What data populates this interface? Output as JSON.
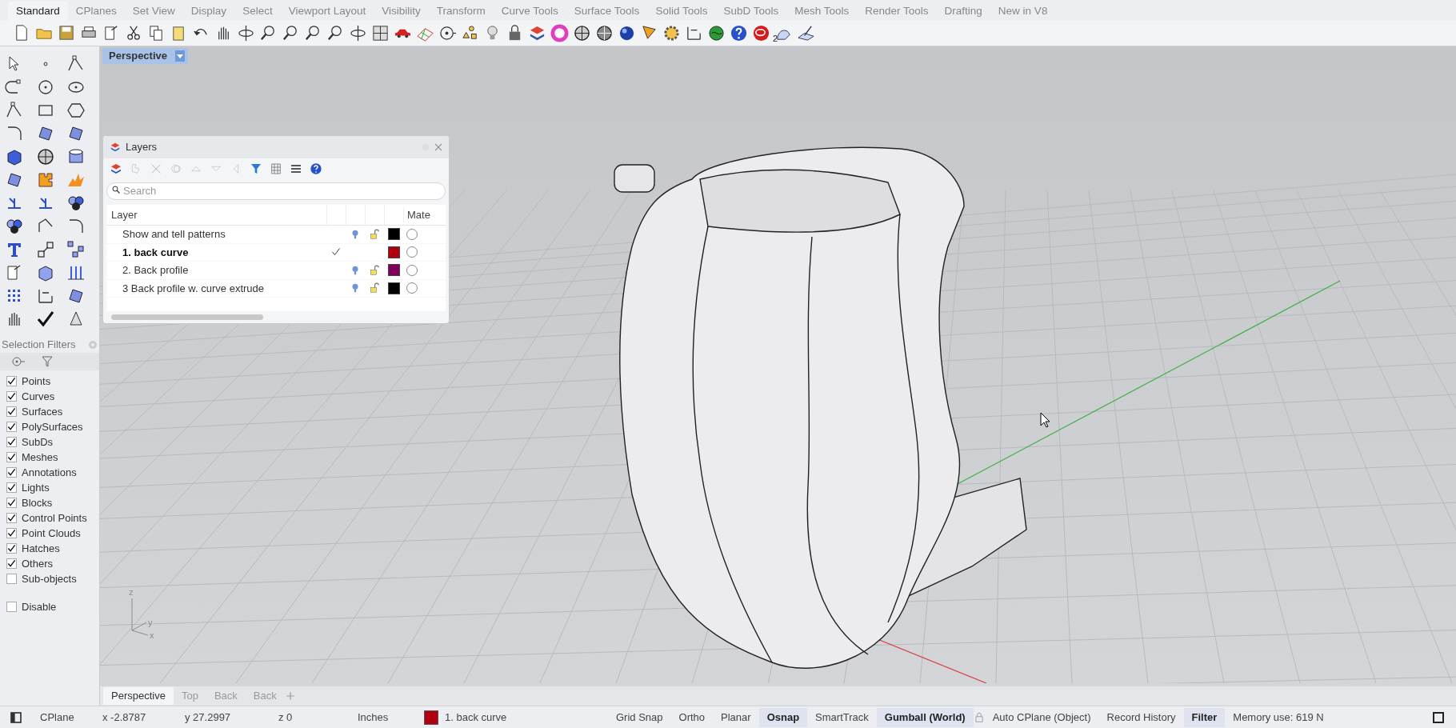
{
  "menu_tabs": [
    {
      "label": "Standard",
      "selected": true
    },
    {
      "label": "CPlanes",
      "selected": false
    },
    {
      "label": "Set View",
      "selected": false
    },
    {
      "label": "Display",
      "selected": false
    },
    {
      "label": "Select",
      "selected": false
    },
    {
      "label": "Viewport Layout",
      "selected": false
    },
    {
      "label": "Visibility",
      "selected": false
    },
    {
      "label": "Transform",
      "selected": false
    },
    {
      "label": "Curve Tools",
      "selected": false
    },
    {
      "label": "Surface Tools",
      "selected": false
    },
    {
      "label": "Solid Tools",
      "selected": false
    },
    {
      "label": "SubD Tools",
      "selected": false
    },
    {
      "label": "Mesh Tools",
      "selected": false
    },
    {
      "label": "Render Tools",
      "selected": false
    },
    {
      "label": "Drafting",
      "selected": false
    },
    {
      "label": "New in V8",
      "selected": false
    }
  ],
  "toolbar_badge": "2",
  "viewport": {
    "title": "Perspective",
    "axes": {
      "x": "x",
      "y": "y",
      "z": "z"
    }
  },
  "layers_panel": {
    "title": "Layers",
    "search": {
      "placeholder": "Search"
    },
    "columns": [
      "Layer",
      "Mate"
    ],
    "rows": [
      {
        "name": "Show and tell patterns",
        "current": false,
        "color": "#000000"
      },
      {
        "name": "1. back curve",
        "current": true,
        "color": "#b00010"
      },
      {
        "name": "2. Back profile",
        "current": false,
        "color": "#800060"
      },
      {
        "name": "3 Back profile w. curve extrude",
        "current": false,
        "color": "#000000"
      }
    ]
  },
  "selection_filters": {
    "title": "Selection Filters",
    "items": [
      {
        "label": "Points",
        "checked": true
      },
      {
        "label": "Curves",
        "checked": true
      },
      {
        "label": "Surfaces",
        "checked": true
      },
      {
        "label": "PolySurfaces",
        "checked": true
      },
      {
        "label": "SubDs",
        "checked": true
      },
      {
        "label": "Meshes",
        "checked": true
      },
      {
        "label": "Annotations",
        "checked": true
      },
      {
        "label": "Lights",
        "checked": true
      },
      {
        "label": "Blocks",
        "checked": true
      },
      {
        "label": "Control Points",
        "checked": true
      },
      {
        "label": "Point Clouds",
        "checked": true
      },
      {
        "label": "Hatches",
        "checked": true
      },
      {
        "label": "Others",
        "checked": true
      },
      {
        "label": "Sub-objects",
        "checked": false
      }
    ],
    "disable": {
      "label": "Disable",
      "checked": false
    }
  },
  "viewport_tabs": [
    {
      "label": "Perspective",
      "selected": true
    },
    {
      "label": "Top",
      "selected": false
    },
    {
      "label": "Back",
      "selected": false
    },
    {
      "label": "Back",
      "selected": false
    }
  ],
  "status_bar": {
    "cplane": "CPlane",
    "x": "x -2.8787",
    "y": "y 27.2997",
    "z": "z 0",
    "units": "Inches",
    "layer": {
      "name": "1. back curve",
      "color": "#b00010"
    },
    "toggles": [
      {
        "label": "Grid Snap",
        "on": false
      },
      {
        "label": "Ortho",
        "on": false
      },
      {
        "label": "Planar",
        "on": false
      },
      {
        "label": "Osnap",
        "on": true
      },
      {
        "label": "SmartTrack",
        "on": false
      },
      {
        "label": "Gumball (World)",
        "on": true
      },
      {
        "label": "Auto CPlane (Object)",
        "on": false,
        "locked": true
      },
      {
        "label": "Record History",
        "on": false
      },
      {
        "label": "Filter",
        "on": true
      }
    ],
    "memory": "Memory use: 619 N"
  }
}
